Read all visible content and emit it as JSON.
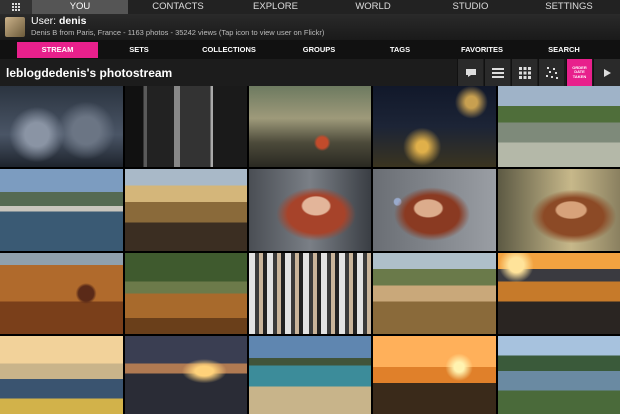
{
  "topnav": {
    "tabs": [
      {
        "label": "YOU",
        "active": true
      },
      {
        "label": "CONTACTS",
        "active": false
      },
      {
        "label": "EXPLORE",
        "active": false
      },
      {
        "label": "WORLD",
        "active": false
      },
      {
        "label": "STUDIO",
        "active": false
      },
      {
        "label": "SETTINGS",
        "active": false
      }
    ]
  },
  "user": {
    "prefix": "User: ",
    "name": "denis",
    "subtitle": "Denis B from Paris, France - 1163 photos - 35242 views (Tap icon to view user on Flickr)"
  },
  "subtabs": [
    {
      "label": "STREAM",
      "active": true
    },
    {
      "label": "SETS",
      "active": false
    },
    {
      "label": "COLLECTIONS",
      "active": false
    },
    {
      "label": "GROUPS",
      "active": false
    },
    {
      "label": "TAGS",
      "active": false
    },
    {
      "label": "FAVORITES",
      "active": false
    },
    {
      "label": "SEARCH",
      "active": false
    }
  ],
  "page_title": "leblogdedenis's photostream",
  "toolbar": {
    "views": [
      "comment-icon",
      "list-view-icon",
      "grid-view-icon",
      "scatter-view-icon",
      "sort-order-icon",
      "play-icon"
    ],
    "sort_label": "ORDER DATE TAKEN"
  },
  "photos": [
    {
      "name": "photo-bicycles"
    },
    {
      "name": "photo-street-bw"
    },
    {
      "name": "photo-cafe-street"
    },
    {
      "name": "photo-night-street"
    },
    {
      "name": "photo-park-walkers"
    },
    {
      "name": "photo-seine-boat"
    },
    {
      "name": "photo-louvre-dusk"
    },
    {
      "name": "photo-portrait-woman"
    },
    {
      "name": "photo-bubbles-woman"
    },
    {
      "name": "photo-woman-backlit"
    },
    {
      "name": "photo-autumn-leaves"
    },
    {
      "name": "photo-park-bench"
    },
    {
      "name": "photo-crowd"
    },
    {
      "name": "photo-wooden-deck"
    },
    {
      "name": "photo-sunset-couple"
    },
    {
      "name": "photo-harbor-sailboats"
    },
    {
      "name": "photo-sunset-sea"
    },
    {
      "name": "photo-beach-cove"
    },
    {
      "name": "photo-pier-sunset"
    },
    {
      "name": "photo-lake-coast"
    }
  ]
}
